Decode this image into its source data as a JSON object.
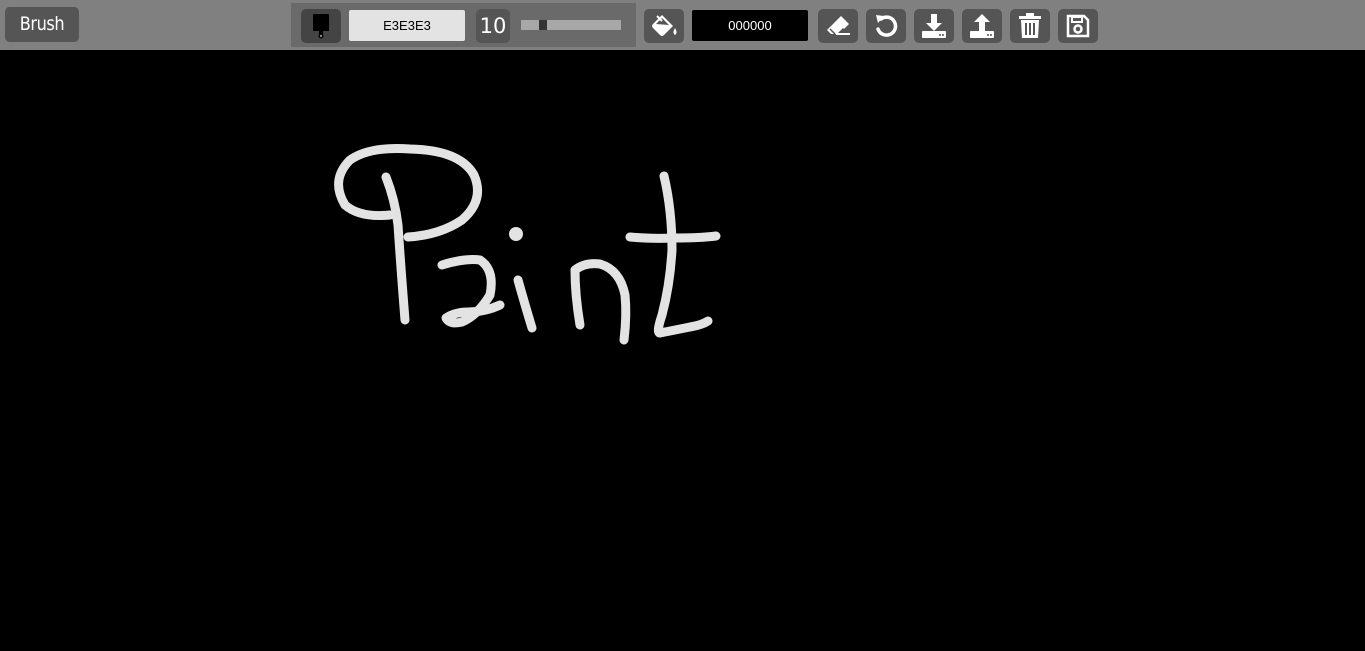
{
  "toolbar": {
    "tool_label": "Brush",
    "brush": {
      "icon": "paintbrush-icon",
      "color_value": "E3E3E3",
      "color": "#E3E3E3",
      "size_value": "10",
      "size_slider_fraction": 0.2
    },
    "fill": {
      "icon": "paint-bucket-icon",
      "color_value": "000000",
      "color": "#000000"
    },
    "actions": [
      {
        "name": "eraser",
        "icon": "eraser-icon"
      },
      {
        "name": "undo",
        "icon": "undo-icon"
      },
      {
        "name": "download",
        "icon": "download-icon"
      },
      {
        "name": "upload",
        "icon": "upload-icon"
      },
      {
        "name": "clear",
        "icon": "trash-icon"
      },
      {
        "name": "save",
        "icon": "floppy-disk-icon"
      }
    ]
  },
  "canvas": {
    "background": "#000000",
    "stroke_color": "#E3E3E3"
  }
}
